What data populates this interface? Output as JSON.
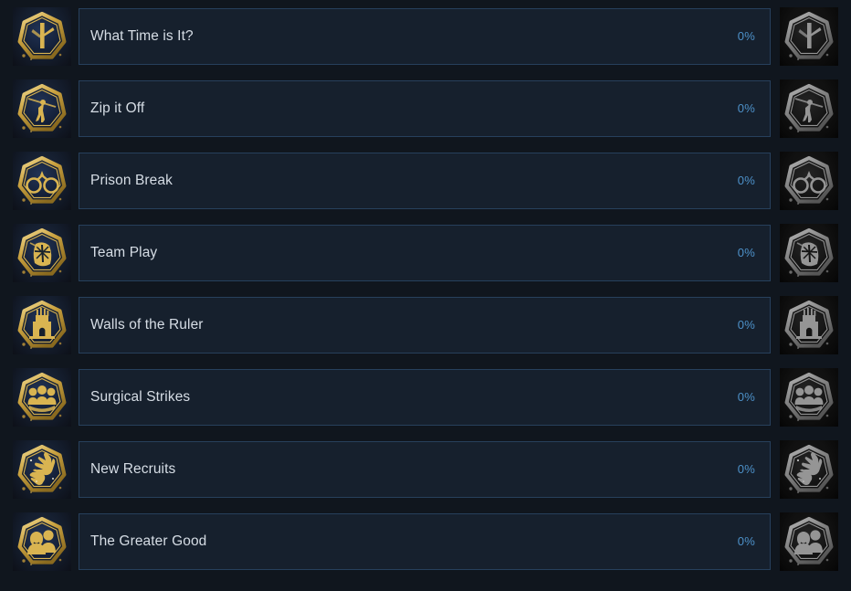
{
  "theme": {
    "page_background": "#10161e",
    "row_background": "#16202d",
    "row_border": "#27405c",
    "title_color": "#d6dde5",
    "percent_color": "#4d91c9",
    "badge_gold": "#d9b451"
  },
  "achievements": [
    {
      "title": "What Time is It?",
      "percent": "0%",
      "icon_name": "clock-hand-badge-icon",
      "locked_icon_name": "clock-hand-badge-locked-icon",
      "glyph": "clock"
    },
    {
      "title": "Zip it Off",
      "percent": "0%",
      "icon_name": "zipline-figure-badge-icon",
      "locked_icon_name": "zipline-figure-badge-locked-icon",
      "glyph": "zipline"
    },
    {
      "title": "Prison Break",
      "percent": "0%",
      "icon_name": "handcuffs-badge-icon",
      "locked_icon_name": "handcuffs-badge-locked-icon",
      "glyph": "handcuffs"
    },
    {
      "title": "Team Play",
      "percent": "0%",
      "icon_name": "team-emblem-badge-icon",
      "locked_icon_name": "team-emblem-badge-locked-icon",
      "glyph": "team"
    },
    {
      "title": "Walls of the Ruler",
      "percent": "0%",
      "icon_name": "castle-tower-badge-icon",
      "locked_icon_name": "castle-tower-badge-locked-icon",
      "glyph": "castle"
    },
    {
      "title": "Surgical Strikes",
      "percent": "0%",
      "icon_name": "three-figures-badge-icon",
      "locked_icon_name": "three-figures-badge-locked-icon",
      "glyph": "trio"
    },
    {
      "title": "New Recruits",
      "percent": "0%",
      "icon_name": "reaching-hands-badge-icon",
      "locked_icon_name": "reaching-hands-badge-locked-icon",
      "glyph": "hands"
    },
    {
      "title": "The Greater Good",
      "percent": "0%",
      "icon_name": "two-figures-badge-icon",
      "locked_icon_name": "two-figures-badge-locked-icon",
      "glyph": "duo"
    }
  ]
}
